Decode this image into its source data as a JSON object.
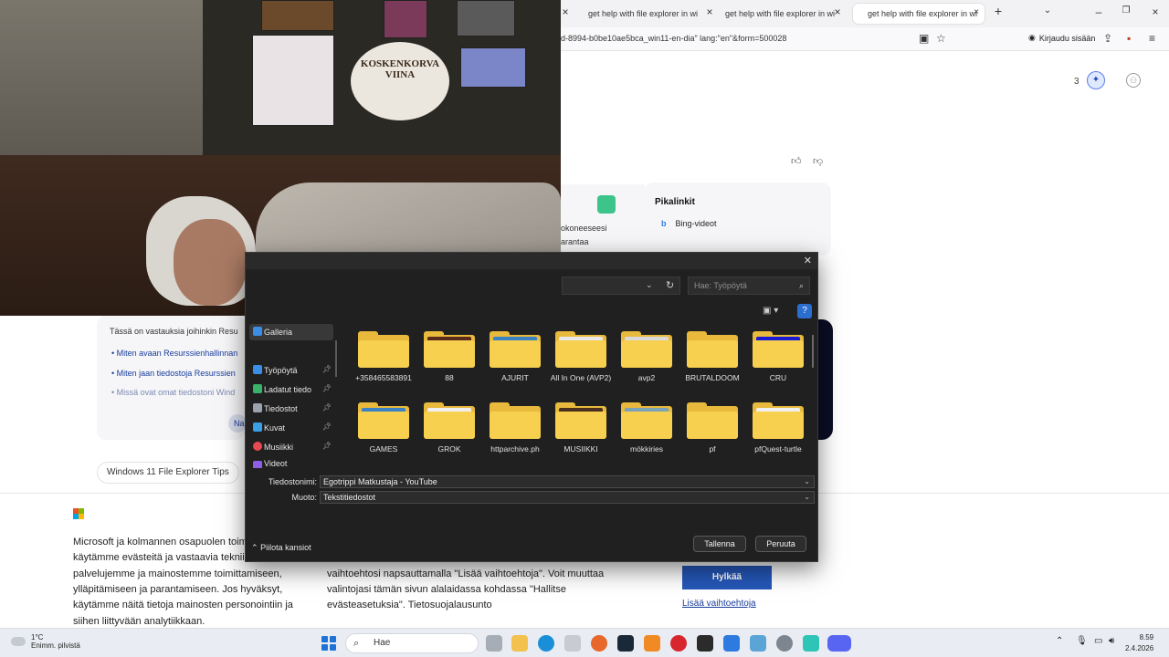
{
  "browser": {
    "tabs": [
      {
        "label": "get help with file explorer in wi"
      },
      {
        "label": "get help with file explorer in wi"
      },
      {
        "label": "get help with file explorer in wi"
      }
    ],
    "url_fragment": "d-8994-b0be10ae5bca_win11-en-dia\" lang:\"en\"&form=500028",
    "signin_label": "Kirjaudu sisään"
  },
  "webcam": {
    "sign_text": "KOSKENKORVA VIINA"
  },
  "page": {
    "count": "3",
    "quick_links_title": "Pikalinkit",
    "quick_links": [
      "Bing-videot"
    ],
    "left_card_lines": [
      "okoneeseesi",
      "arantaa"
    ],
    "answers_intro": "Tässä on vastauksia joihinkin Resu",
    "answers": [
      "Miten avaan Resurssienhallinnan",
      "Miten jaan tiedostoja Resurssien",
      "Missä ovat omat tiedostoni Wind"
    ],
    "na_button": "Na",
    "chip_label": "Windows 11 File Explorer Tips"
  },
  "cookie": {
    "left_lines": [
      "Microsoft ja kolmannen osapuolen toim",
      "käytämme evästeitä ja vastaavia tekniik",
      "palvelujemme ja mainostemme toimittamiseen,",
      "ylläpitämiseen ja parantamiseen. Jos hyväksyt,",
      "käytämme näitä tietoja mainosten personointiin ja",
      "siihen liittyvään analytiikkaan."
    ],
    "mid_lines": [
      "vaihtoehtosi napsauttamalla \"Lisää vaihtoehtoja\". Voit muuttaa",
      "valintojasi tämän sivun alalaidassa kohdassa \"Hallitse",
      "evästeasetuksia\". Tietosuojalausunto"
    ],
    "reject_button": "Hylkää",
    "more_options": "Lisää vaihtoehtoja"
  },
  "dialog": {
    "search_placeholder": "Hae: Työpöytä",
    "nav": [
      {
        "label": "Galleria",
        "icon": "gallery-icon",
        "color": "#3a8ee6",
        "pinned": false,
        "selected": true
      },
      {
        "label": "Työpöytä",
        "icon": "desktop-icon",
        "color": "#3a8ee6",
        "pinned": true,
        "selected": false
      },
      {
        "label": "Ladatut tiedo",
        "icon": "download-icon",
        "color": "#37b36a",
        "pinned": true,
        "selected": false
      },
      {
        "label": "Tiedostot",
        "icon": "document-icon",
        "color": "#9aa3ad",
        "pinned": true,
        "selected": false
      },
      {
        "label": "Kuvat",
        "icon": "pictures-icon",
        "color": "#3aa0e6",
        "pinned": true,
        "selected": false
      },
      {
        "label": "Musiikki",
        "icon": "music-icon",
        "color": "#e6494f",
        "pinned": true,
        "selected": false
      },
      {
        "label": "Videot",
        "icon": "videos-icon",
        "color": "#8e5ee6",
        "pinned": true,
        "selected": false
      }
    ],
    "folders": [
      {
        "name": "+358465583891",
        "thumb": ""
      },
      {
        "name": "88",
        "thumb": "#5a2a1a"
      },
      {
        "name": "AJURIT",
        "thumb": "#3b82c4"
      },
      {
        "name": "All In One (AVP2)",
        "thumb": "#e8e8e8"
      },
      {
        "name": "avp2",
        "thumb": "#d9d9d9"
      },
      {
        "name": "BRUTALDOOM",
        "thumb": ""
      },
      {
        "name": "CRU",
        "thumb": "#1a1ad6"
      },
      {
        "name": "GAMES",
        "thumb": "#3b82c4"
      },
      {
        "name": "GROK",
        "thumb": "#f0f0f0"
      },
      {
        "name": "httparchive.ph",
        "thumb": ""
      },
      {
        "name": "MUSIIKKI",
        "thumb": "#4a2e1e"
      },
      {
        "name": "mökkiries",
        "thumb": "#7aa3b8"
      },
      {
        "name": "pf",
        "thumb": ""
      },
      {
        "name": "pfQuest-turtle",
        "thumb": "#f0f0f0"
      }
    ],
    "filename_label": "Tiedostonimi:",
    "filename_value": "Egotrippi Matkustaja - YouTube",
    "type_label": "Muoto:",
    "type_value": "Tekstitiedostot",
    "hide_folders": "Piilota kansiot",
    "save_button": "Tallenna",
    "cancel_button": "Peruuta"
  },
  "taskbar": {
    "temp": "1°C",
    "weather": "Enimm. pilvistä",
    "search": "Hae",
    "time": "8.59",
    "date": "2.4.2026"
  }
}
